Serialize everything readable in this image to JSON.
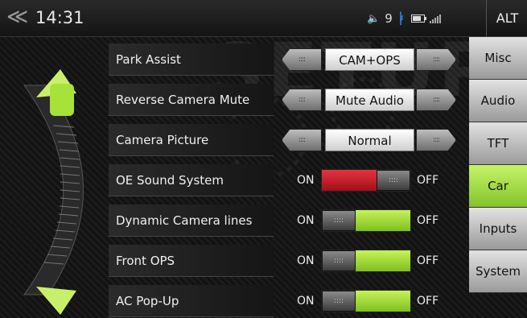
{
  "header": {
    "back_icon": "back-chevrons-icon",
    "time": "14:31",
    "volume_level": "9",
    "mode_button": "ALT",
    "status_icons": [
      "volume-icon",
      "bluetooth-icon",
      "battery-icon",
      "signal-icon"
    ]
  },
  "watermark": "SETUP",
  "settings": [
    {
      "label": "Park Assist",
      "type": "selector",
      "value": "CAM+OPS"
    },
    {
      "label": "Reverse Camera Mute",
      "type": "selector",
      "value": "Mute Audio"
    },
    {
      "label": "Camera Picture",
      "type": "selector",
      "value": "Normal"
    },
    {
      "label": "OE Sound System",
      "type": "toggle",
      "state": "on",
      "on_label": "ON",
      "off_label": "OFF"
    },
    {
      "label": "Dynamic Camera lines",
      "type": "toggle",
      "state": "off",
      "on_label": "ON",
      "off_label": "OFF"
    },
    {
      "label": "Front OPS",
      "type": "toggle",
      "state": "off",
      "on_label": "ON",
      "off_label": "OFF"
    },
    {
      "label": "AC Pop-Up",
      "type": "toggle",
      "state": "off",
      "on_label": "ON",
      "off_label": "OFF"
    }
  ],
  "sidebar": {
    "tabs": [
      {
        "label": "Misc",
        "active": false
      },
      {
        "label": "Audio",
        "active": false
      },
      {
        "label": "TFT",
        "active": false
      },
      {
        "label": "Car",
        "active": true
      },
      {
        "label": "Inputs",
        "active": false
      },
      {
        "label": "System",
        "active": false
      }
    ]
  },
  "colors": {
    "accent_green": "#9fdc3a",
    "toggle_red": "#d0202c",
    "bluetooth_blue": "#2e8bff"
  }
}
